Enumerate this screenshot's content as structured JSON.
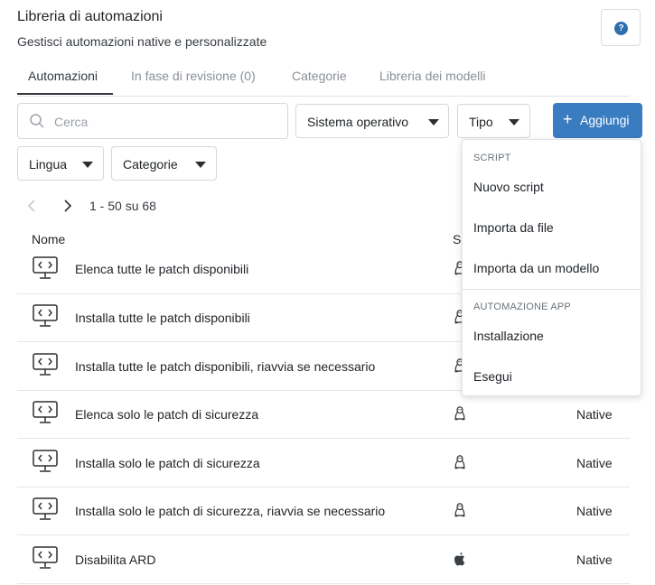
{
  "header": {
    "title": "Libreria di automazioni",
    "subtitle": "Gestisci automazioni native e personalizzate",
    "help_icon": "question-circle-icon"
  },
  "tabs": [
    {
      "label": "Automazioni",
      "active": true
    },
    {
      "label": "In fase di revisione (0)",
      "active": false
    },
    {
      "label": "Categorie",
      "active": false
    },
    {
      "label": "Libreria dei modelli",
      "active": false
    }
  ],
  "filters": {
    "search_placeholder": "Cerca",
    "os_label": "Sistema operativo",
    "type_label": "Tipo",
    "language_label": "Lingua",
    "categories_label": "Categorie",
    "add_label": "Aggiungi"
  },
  "pagination": {
    "range": "1 - 50 su 68"
  },
  "table": {
    "columns": [
      "Nome",
      "S"
    ],
    "rows": [
      {
        "name": "Elenca tutte le patch disponibili",
        "os": "linux",
        "type": ""
      },
      {
        "name": "Installa tutte le patch disponibili",
        "os": "linux",
        "type": ""
      },
      {
        "name": "Installa tutte le patch disponibili, riavvia se necessario",
        "os": "linux",
        "type": ""
      },
      {
        "name": "Elenca solo le patch di sicurezza",
        "os": "linux",
        "type": "Native"
      },
      {
        "name": "Installa solo le patch di sicurezza",
        "os": "linux",
        "type": "Native"
      },
      {
        "name": "Installa solo le patch di sicurezza, riavvia se necessario",
        "os": "linux",
        "type": "Native"
      },
      {
        "name": "Disabilita ARD",
        "os": "apple",
        "type": "Native"
      }
    ]
  },
  "menu": {
    "sections": [
      {
        "header": "SCRIPT",
        "items": [
          "Nuovo script",
          "Importa da file",
          "Importa da un modello"
        ]
      },
      {
        "header": "AUTOMAZIONE APP",
        "items": [
          "Installazione",
          "Esegui"
        ]
      }
    ]
  },
  "colors": {
    "accent": "#3a7cc0",
    "help": "#2d6fae",
    "text": "#212529"
  }
}
